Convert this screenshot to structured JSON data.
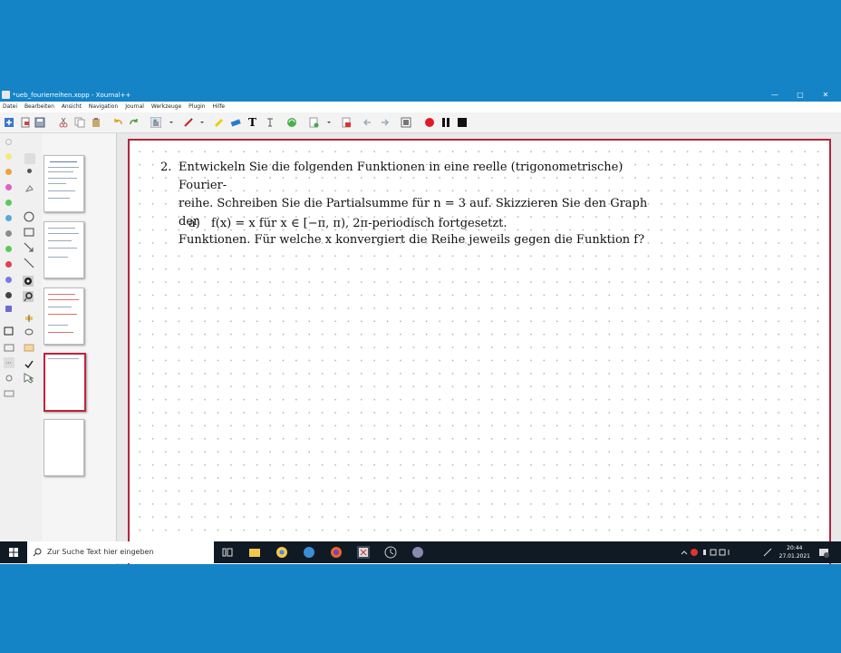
{
  "window": {
    "title": "*ueb_fourierreihen.xopp - Xournal++",
    "controls": {
      "minimize": "—",
      "maximize": "▢",
      "close": "✕"
    }
  },
  "menu": [
    "Datei",
    "Bearbeiten",
    "Ansicht",
    "Navigation",
    "Journal",
    "Werkzeuge",
    "Plugin",
    "Hilfe"
  ],
  "colors": {
    "accent": "#1484c6",
    "page_border": "#b3253e",
    "record": "#e01b24",
    "selected_thumb": "#c4213a"
  },
  "toolbar_icons": [
    "new-icon",
    "open-icon",
    "save-icon",
    "cut-icon",
    "copy-icon",
    "paste-icon",
    "undo-icon",
    "redo-icon",
    "hand-icon",
    "pen-icon",
    "eraser-icon",
    "highlighter-icon",
    "image-icon",
    "text-icon",
    "tex-icon",
    "refresh-icon",
    "page-add-icon",
    "delete-page-icon",
    "prev-icon",
    "next-icon",
    "fullscreen-icon",
    "record-icon",
    "pause-icon",
    "stop-icon"
  ],
  "palette": [
    "#f5e97a",
    "#f0a040",
    "#e060c0",
    "#5bc85b",
    "#5aa8d8",
    "#8c8c8c",
    "#5bc85b",
    "#e04050",
    "#7a7ae0",
    "#444444",
    "#6a6ad8"
  ],
  "sidebar_pages": [
    1,
    2,
    3,
    4,
    5
  ],
  "sidebar_footer_icons": [
    "page-up-icon",
    "page-down-icon",
    "copy-page-icon",
    "delete-page-icon",
    "close-icon"
  ],
  "document": {
    "problem_number": "2.",
    "problem_lines": [
      "Entwickeln Sie die folgenden Funktionen in eine reelle (trigonometrische) Fourier-",
      "reihe. Schreiben Sie die Partialsumme für n = 3 auf. Skizzieren Sie den Graph der",
      "Funktionen. Für welche x konvergiert die Reihe jeweils gegen die Funktion f?"
    ],
    "sub_label": "a)",
    "sub_text": "f(x) = x für x ∈ [−π, π), 2π-periodisch fortgesetzt."
  },
  "taskbar": {
    "search_placeholder": "Zur Suche Text hier eingeben",
    "time": "20:44",
    "date": "27.01.2021"
  }
}
